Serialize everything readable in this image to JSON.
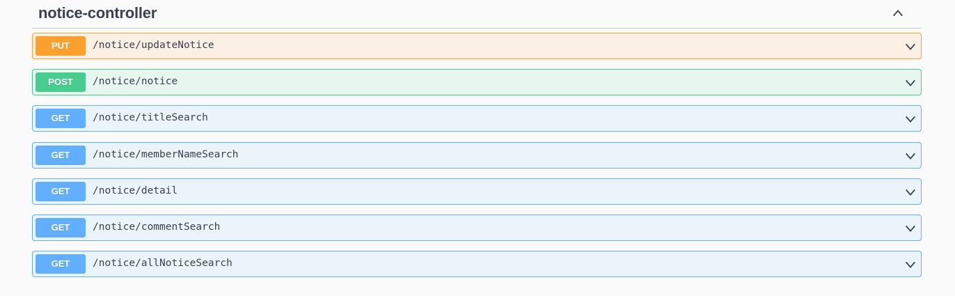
{
  "section": {
    "title": "notice-controller",
    "collapse_icon": "chevron-up-icon"
  },
  "operations": [
    {
      "method": "PUT",
      "path": "/notice/updateNotice",
      "color": "#fca130",
      "bg": "#fcf0e5"
    },
    {
      "method": "POST",
      "path": "/notice/notice",
      "color": "#49cc90",
      "bg": "#e8f6f0"
    },
    {
      "method": "GET",
      "path": "/notice/titleSearch",
      "color": "#61affe",
      "bg": "#ebf3fb"
    },
    {
      "method": "GET",
      "path": "/notice/memberNameSearch",
      "color": "#61affe",
      "bg": "#ebf3fb"
    },
    {
      "method": "GET",
      "path": "/notice/detail",
      "color": "#61affe",
      "bg": "#ebf3fb"
    },
    {
      "method": "GET",
      "path": "/notice/commentSearch",
      "color": "#61affe",
      "bg": "#ebf3fb"
    },
    {
      "method": "GET",
      "path": "/notice/allNoticeSearch",
      "color": "#61affe",
      "bg": "#ebf3fb"
    }
  ],
  "expand_icon": "chevron-down-icon"
}
